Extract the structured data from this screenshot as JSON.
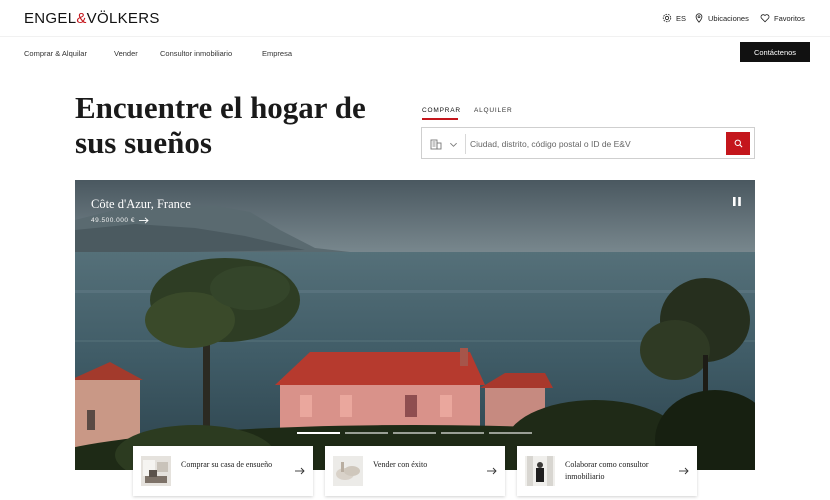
{
  "header": {
    "logo_left": "ENGEL",
    "logo_amp": "&",
    "logo_right": "VÖLKERS",
    "language": "ES",
    "locations": "Ubicaciones",
    "favorites": "Favoritos"
  },
  "nav": {
    "items": [
      "Comprar & Alquilar",
      "Vender",
      "Consultor inmobiliario",
      "Empresa"
    ],
    "contact_label": "Contáctenos"
  },
  "hero": {
    "title": "Encuentre el hogar de sus sueños"
  },
  "search": {
    "tabs": [
      "COMPRAR",
      "ALQUILER"
    ],
    "active_tab": "COMPRAR",
    "placeholder": "Ciudad, distrito, código postal o ID de E&V"
  },
  "slide": {
    "location": "Côte d'Azur, France",
    "price": "49.500.000 €",
    "dot_count": 5,
    "active_dot": 0
  },
  "cards": [
    {
      "label": "Comprar su casa de ensueño"
    },
    {
      "label": "Vender con éxito"
    },
    {
      "label": "Colaborar como consultor inmobiliario"
    }
  ],
  "colors": {
    "brand_red": "#c4161c",
    "text_dark": "#1a1a1a",
    "button_dark": "#111111"
  }
}
